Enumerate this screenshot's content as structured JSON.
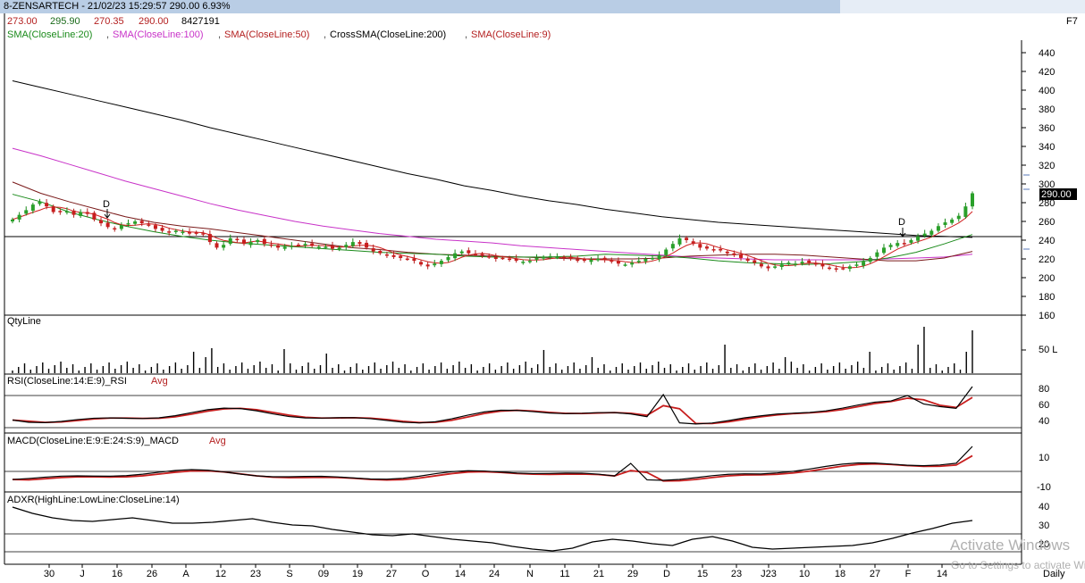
{
  "window": {
    "title": "8-ZENSARTECH - 21/02/23 15:29:57 290.00 6.93%",
    "key_hint": "F7"
  },
  "ohlc_header": {
    "open": "273.00",
    "high": "295.90",
    "low": "270.35",
    "close": "290.00",
    "volume": "8427191"
  },
  "indicators": [
    {
      "label": "SMA(CloseLine:20)",
      "color": "#1a8a1a"
    },
    {
      "label": "SMA(CloseLine:100)",
      "color": "#c832c8"
    },
    {
      "label": "SMA(CloseLine:50)",
      "color": "#b42020"
    },
    {
      "label": "CrossSMA(CloseLine:200)",
      "color": "#000000"
    },
    {
      "label": "SMA(CloseLine:9)",
      "color": "#b42020"
    }
  ],
  "panels": {
    "qty": {
      "label": "QtyLine",
      "tick_label": "50 L"
    },
    "rsi": {
      "label": "RSI(CloseLine:14:E:9)_RSI",
      "avg": "Avg",
      "ticks": [
        "80",
        "60",
        "40"
      ]
    },
    "macd": {
      "label": "MACD(CloseLine:E:9:E:24:S:9)_MACD",
      "avg": "Avg",
      "ticks": [
        "10",
        "-10"
      ]
    },
    "adxr": {
      "label": "ADXR(HighLine:LowLine:CloseLine:14)",
      "ticks": [
        "40",
        "30",
        "20"
      ]
    }
  },
  "last_price_label": "290.00",
  "cross_markers": [
    "D",
    "D"
  ],
  "periodicity": "Daily",
  "watermark": {
    "line1": "Activate Windows",
    "line2": "Go to Settings to activate Windows."
  },
  "chart_data": {
    "type": "line",
    "title": "8-ZENSARTECH",
    "price_axis": {
      "ticks": [
        440,
        420,
        400,
        380,
        360,
        340,
        320,
        300,
        280,
        260,
        240,
        220,
        200,
        180,
        160
      ],
      "ylim": [
        155,
        450
      ]
    },
    "x_tick_labels": [
      "30",
      "J",
      "16",
      "26",
      "A",
      "12",
      "23",
      "S",
      "09",
      "19",
      "27",
      "O",
      "14",
      "24",
      "N",
      "11",
      "21",
      "29",
      "D",
      "15",
      "23",
      "J23",
      "10",
      "18",
      "27",
      "F",
      "14"
    ],
    "price_bars": [
      262,
      267,
      272,
      278,
      281,
      276,
      270,
      270,
      271,
      267,
      270,
      268,
      262,
      258,
      254,
      252,
      256,
      258,
      260,
      258,
      256,
      252,
      250,
      248,
      250,
      249,
      247,
      248,
      246,
      238,
      232,
      235,
      242,
      240,
      236,
      238,
      240,
      236,
      234,
      232,
      233,
      234,
      235,
      236,
      234,
      233,
      233,
      231,
      232,
      235,
      238,
      236,
      232,
      228,
      226,
      224,
      222,
      221,
      220,
      218,
      214,
      212,
      215,
      218,
      222,
      226,
      228,
      226,
      225,
      224,
      222,
      220,
      221,
      220,
      218,
      217,
      218,
      221,
      222,
      223,
      222,
      221,
      220,
      219,
      218,
      219,
      220,
      219,
      217,
      215,
      214,
      216,
      218,
      220,
      221,
      224,
      230,
      236,
      242,
      240,
      236,
      232,
      231,
      230,
      229,
      226,
      224,
      221,
      218,
      216,
      212,
      210,
      212,
      214,
      216,
      215,
      217,
      216,
      214,
      212,
      210,
      209,
      210,
      212,
      214,
      217,
      221,
      227,
      232,
      235,
      237,
      236,
      240,
      244,
      247,
      250,
      255,
      259,
      262,
      266,
      276,
      290
    ],
    "series": [
      {
        "name": "SMA(CloseLine:200)",
        "values": [
          410,
          403,
          396,
          389,
          382,
          375,
          368,
          360,
          353,
          346,
          339,
          332,
          325,
          318,
          311,
          305,
          298,
          293,
          287,
          282,
          278,
          273,
          269,
          265,
          262,
          259,
          257,
          255,
          253,
          251,
          249,
          247,
          245,
          244,
          243
        ]
      },
      {
        "name": "SMA(CloseLine:100)",
        "values": [
          338,
          330,
          321,
          312,
          303,
          295,
          287,
          279,
          272,
          266,
          260,
          255,
          251,
          247,
          244,
          241,
          239,
          237,
          234,
          232,
          230,
          228,
          226,
          224,
          222,
          221,
          220,
          219,
          219,
          219,
          219,
          220,
          221,
          222,
          225
        ]
      },
      {
        "name": "SMA(CloseLine:50)",
        "values": [
          302,
          290,
          281,
          273,
          265,
          259,
          255,
          252,
          248,
          244,
          240,
          236,
          232,
          230,
          227,
          225,
          224,
          223,
          222,
          221,
          220,
          220,
          220,
          221,
          223,
          224,
          225,
          225,
          224,
          222,
          220,
          218,
          218,
          221,
          228
        ]
      },
      {
        "name": "SMA(CloseLine:20)",
        "values": [
          289,
          281,
          270,
          262,
          255,
          249,
          244,
          240,
          237,
          235,
          233,
          231,
          229,
          227,
          226,
          225,
          223,
          222,
          222,
          222,
          223,
          225,
          224,
          223,
          221,
          218,
          216,
          215,
          214,
          215,
          217,
          221,
          227,
          236,
          246
        ]
      }
    ]
  }
}
